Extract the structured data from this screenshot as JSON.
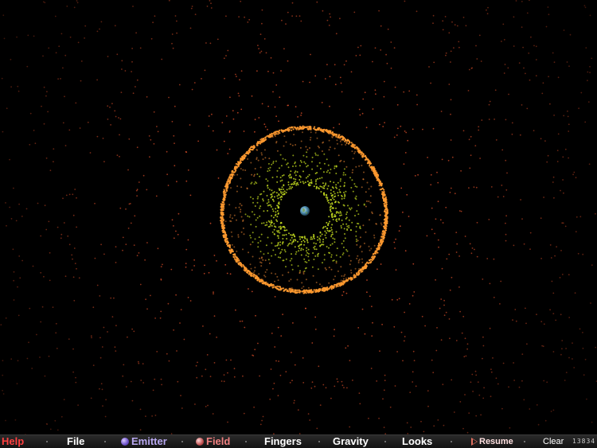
{
  "canvas": {
    "background": "#000000",
    "ring_color": "#ff9a30",
    "inner_particle_color": "#c8e020",
    "outer_particle_color": "#e0502a",
    "core_icon": "earth-globe-icon"
  },
  "toolbar": {
    "help_label": "Help",
    "file_label": "File",
    "emitter_label": "Emitter",
    "field_label": "Field",
    "fingers_label": "Fingers",
    "gravity_label": "Gravity",
    "looks_label": "Looks",
    "resume_label": "Resume",
    "clear_label": "Clear",
    "particle_count": "13834",
    "colors": {
      "help": "#ff4040",
      "default": "#ffffff",
      "emitter": "#b8a8f0",
      "field": "#f08080",
      "resume": "#ffe0e0"
    }
  }
}
